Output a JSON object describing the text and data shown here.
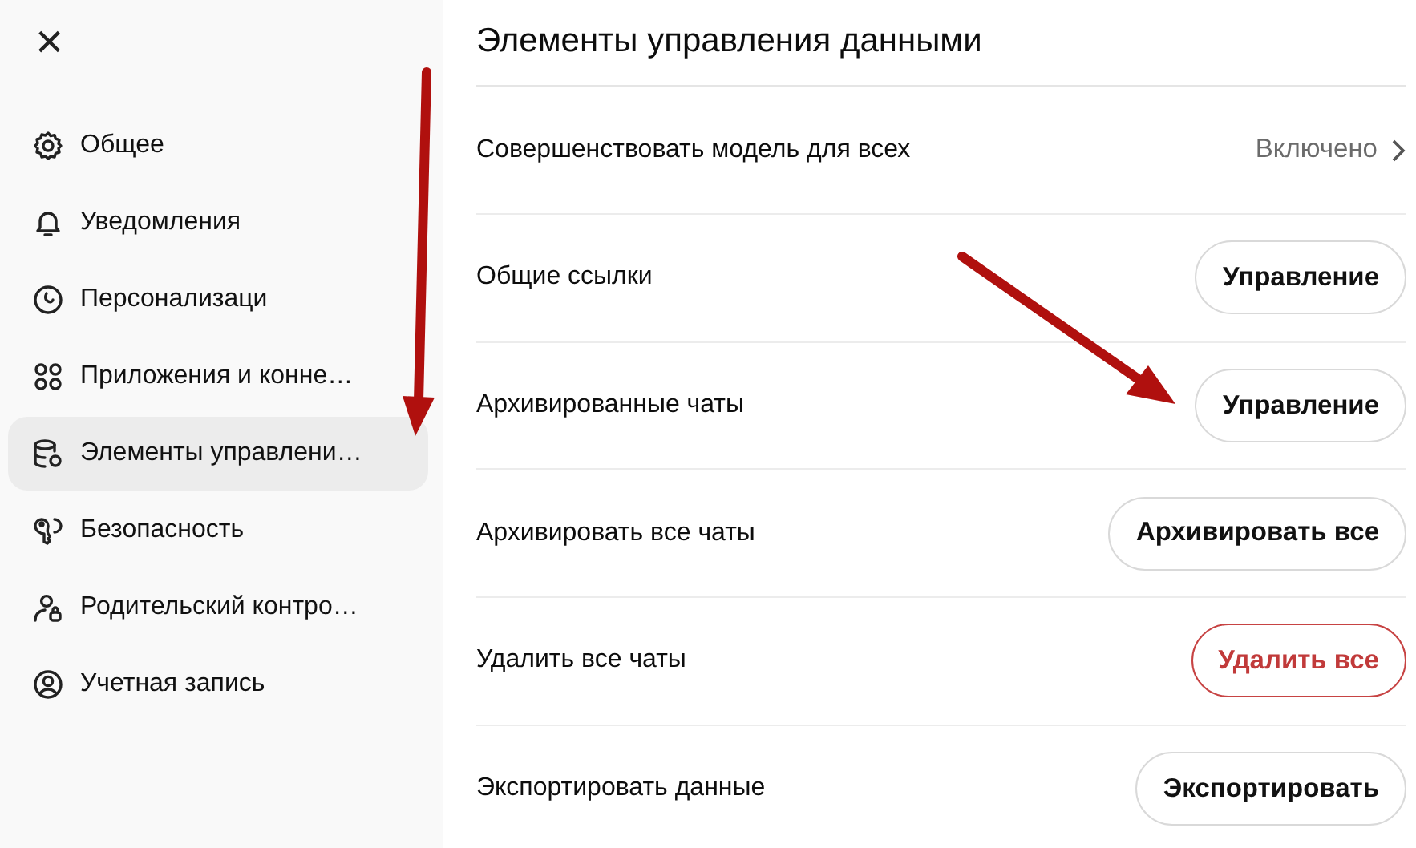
{
  "sidebar": {
    "close": "×",
    "items": [
      {
        "label": "Общее",
        "selected": false
      },
      {
        "label": "Уведомления",
        "selected": false
      },
      {
        "label": "Персонализаци",
        "selected": false
      },
      {
        "label": "Приложения и конне…",
        "selected": false
      },
      {
        "label": "Элементы управлени…",
        "selected": true
      },
      {
        "label": "Безопасность",
        "selected": false
      },
      {
        "label": "Родительский контро…",
        "selected": false
      },
      {
        "label": "Учетная запись",
        "selected": false
      }
    ]
  },
  "main": {
    "title": "Элементы управления данными",
    "rows": [
      {
        "label": "Совершенствовать модель для всех",
        "kind": "link",
        "value": "Включено"
      },
      {
        "label": "Общие ссылки",
        "kind": "button",
        "action": "Управление"
      },
      {
        "label": "Архивированные чаты",
        "kind": "button",
        "action": "Управление"
      },
      {
        "label": "Архивировать все чаты",
        "kind": "button",
        "action": "Архивировать все"
      },
      {
        "label": "Удалить все чаты",
        "kind": "danger",
        "action": "Удалить все"
      },
      {
        "label": "Экспортировать данные",
        "kind": "button",
        "action": "Экспортировать"
      }
    ]
  }
}
